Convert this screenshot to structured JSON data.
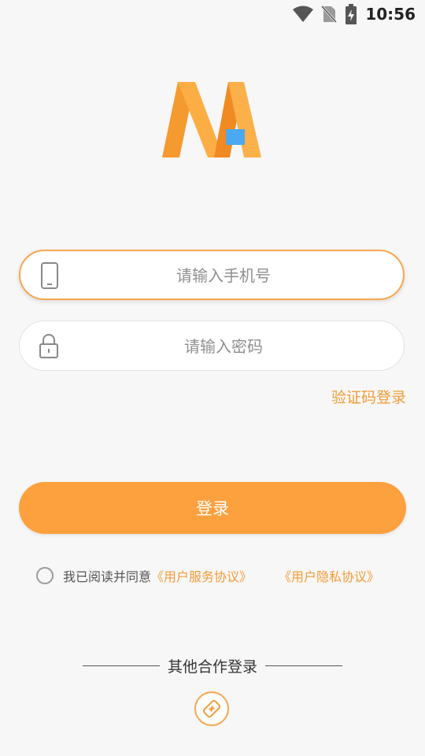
{
  "status_bar": {
    "time": "10:56"
  },
  "login_form": {
    "phone_placeholder": "请输入手机号",
    "password_placeholder": "请输入密码",
    "code_login_label": "验证码登录",
    "login_button": "登录"
  },
  "agreement": {
    "prefix": "我已阅读并同意",
    "terms_link": "《用户服务协议》",
    "privacy_link": "《用户隐私协议》"
  },
  "other_login": {
    "label": "其他合作登录"
  },
  "colors": {
    "accent": "#fda03e",
    "link": "#f49b36",
    "logo_blue": "#4aa9f0"
  }
}
